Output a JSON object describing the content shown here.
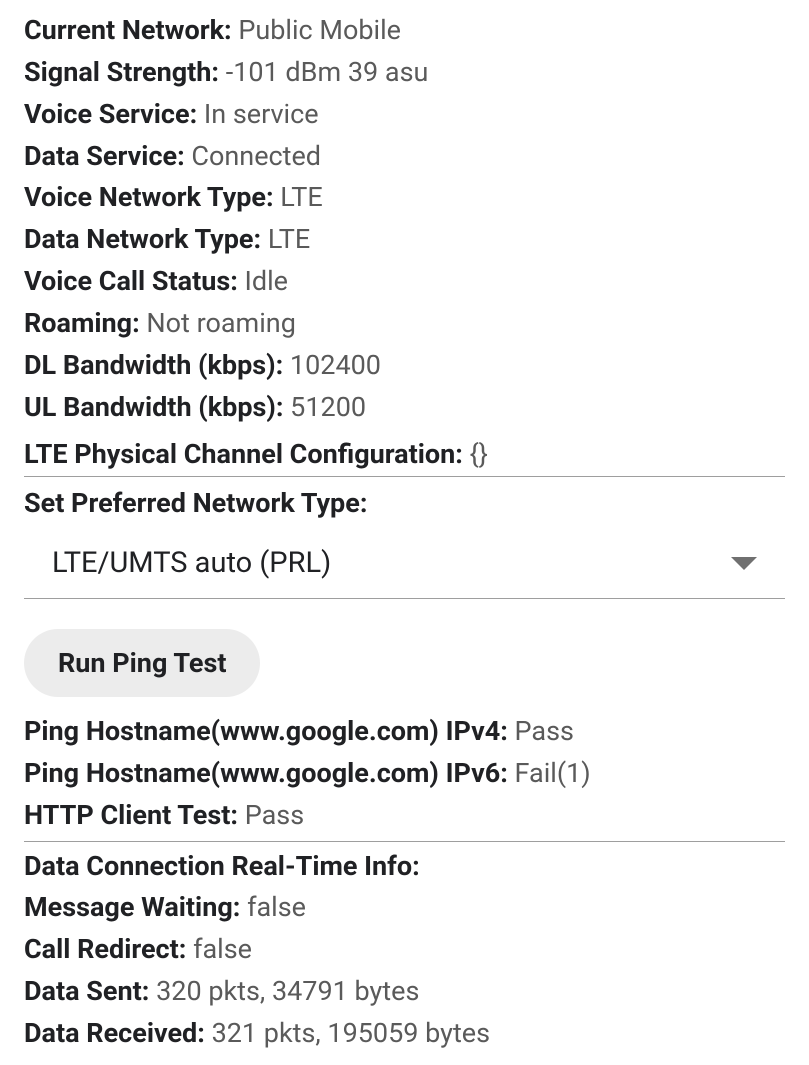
{
  "network": {
    "current_network": {
      "label": "Current Network:",
      "value": "Public Mobile"
    },
    "signal_strength": {
      "label": "Signal Strength:",
      "value": "-101 dBm   39 asu"
    },
    "voice_service": {
      "label": "Voice Service:",
      "value": "In service"
    },
    "data_service": {
      "label": "Data Service:",
      "value": "Connected"
    },
    "voice_network_type": {
      "label": "Voice Network Type:",
      "value": "LTE"
    },
    "data_network_type": {
      "label": "Data Network Type:",
      "value": "LTE"
    },
    "voice_call_status": {
      "label": "Voice Call Status:",
      "value": "Idle"
    },
    "roaming": {
      "label": "Roaming:",
      "value": "Not roaming"
    },
    "dl_bandwidth": {
      "label": "DL Bandwidth (kbps):",
      "value": "102400"
    },
    "ul_bandwidth": {
      "label": "UL Bandwidth (kbps):",
      "value": "51200"
    },
    "lte_phy_channel": {
      "label": "LTE Physical Channel Configuration:",
      "value": "{}"
    }
  },
  "preferred": {
    "header": "Set Preferred Network Type:",
    "selected": "LTE/UMTS auto (PRL)"
  },
  "ping": {
    "button_label": "Run Ping Test",
    "ipv4": {
      "label": "Ping Hostname(www.google.com) IPv4:",
      "value": "Pass"
    },
    "ipv6": {
      "label": "Ping Hostname(www.google.com) IPv6:",
      "value": "Fail(1)"
    },
    "http_client": {
      "label": "HTTP Client Test:",
      "value": "Pass"
    }
  },
  "realtime": {
    "header": "Data Connection Real-Time Info:",
    "message_waiting": {
      "label": "Message Waiting:",
      "value": "false"
    },
    "call_redirect": {
      "label": "Call Redirect:",
      "value": "false"
    },
    "data_sent": {
      "label": "Data Sent:",
      "value": "320 pkts, 34791 bytes"
    },
    "data_received": {
      "label": "Data Received:",
      "value": "321 pkts, 195059 bytes"
    }
  }
}
